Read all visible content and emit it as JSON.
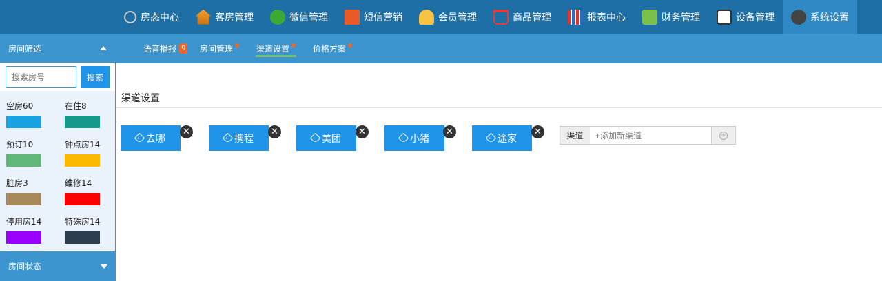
{
  "nav": [
    {
      "icon": "bike-icon",
      "label": "房态中心"
    },
    {
      "icon": "house-icon",
      "label": "客房管理"
    },
    {
      "icon": "wechat-icon",
      "label": "微信管理"
    },
    {
      "icon": "sms-icon",
      "label": "短信营销"
    },
    {
      "icon": "member-icon",
      "label": "会员管理"
    },
    {
      "icon": "cart-icon",
      "label": "商品管理"
    },
    {
      "icon": "report-icon",
      "label": "报表中心"
    },
    {
      "icon": "money-icon",
      "label": "财务管理"
    },
    {
      "icon": "device-icon",
      "label": "设备管理"
    },
    {
      "icon": "settings-icon",
      "label": "系统设置",
      "active": true
    }
  ],
  "sidebar": {
    "filter_title": "房间筛选",
    "search_placeholder": "搜索房号",
    "search_button": "搜索",
    "legend": [
      {
        "label": "空房60",
        "color": "#18a3e0"
      },
      {
        "label": "在住8",
        "color": "#14998a"
      },
      {
        "label": "预订10",
        "color": "#5fb878"
      },
      {
        "label": "钟点房14",
        "color": "#fbb900"
      },
      {
        "label": "脏房3",
        "color": "#a8895a"
      },
      {
        "label": "维修14",
        "color": "#ff0000"
      },
      {
        "label": "停用房14",
        "color": "#9900ff"
      },
      {
        "label": "特殊房14",
        "color": "#2c3e50"
      }
    ],
    "status_title": "房间状态"
  },
  "subnav": [
    {
      "label": "语音播报",
      "badge": "9"
    },
    {
      "label": "房间管理",
      "dot": true
    },
    {
      "label": "渠道设置",
      "dot": true,
      "active": true
    },
    {
      "label": "价格方案",
      "dot": true
    }
  ],
  "main": {
    "section_title": "渠道设置",
    "channels": [
      "去哪",
      "携程",
      "美团",
      "小猪",
      "途家"
    ],
    "input_addon": "渠道",
    "input_placeholder": "+添加新渠道"
  }
}
